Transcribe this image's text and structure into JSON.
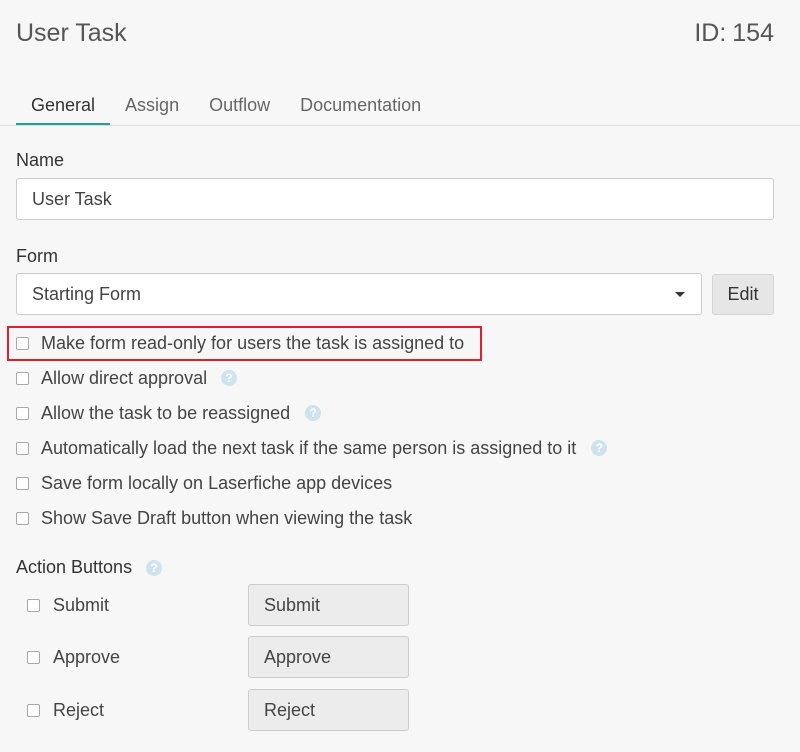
{
  "header": {
    "title": "User Task",
    "id_label": "ID:",
    "id_value": "154"
  },
  "tabs": [
    {
      "label": "General",
      "active": true
    },
    {
      "label": "Assign",
      "active": false
    },
    {
      "label": "Outflow",
      "active": false
    },
    {
      "label": "Documentation",
      "active": false
    }
  ],
  "name_field": {
    "label": "Name",
    "value": "User Task"
  },
  "form_field": {
    "label": "Form",
    "selected": "Starting Form",
    "edit_label": "Edit"
  },
  "options": [
    {
      "label": "Make form read-only for users the task is assigned to",
      "checked": false,
      "help": false
    },
    {
      "label": "Allow direct approval",
      "checked": false,
      "help": true
    },
    {
      "label": "Allow the task to be reassigned",
      "checked": false,
      "help": true
    },
    {
      "label": "Automatically load the next task if the same person is assigned to it",
      "checked": false,
      "help": true
    },
    {
      "label": "Save form locally on Laserfiche app devices",
      "checked": false,
      "help": false
    },
    {
      "label": "Show Save Draft button when viewing the task",
      "checked": false,
      "help": false
    }
  ],
  "action_buttons": {
    "label": "Action Buttons",
    "items": [
      {
        "label": "Submit",
        "value": "Submit",
        "checked": false
      },
      {
        "label": "Approve",
        "value": "Approve",
        "checked": false
      },
      {
        "label": "Reject",
        "value": "Reject",
        "checked": false
      }
    ]
  },
  "icons": {
    "help": "help-icon",
    "dropdown": "chevron-down-icon"
  },
  "colors": {
    "accent": "#1fa58f",
    "highlight": "#e0202a",
    "help_icon": "#cfe3ee"
  }
}
